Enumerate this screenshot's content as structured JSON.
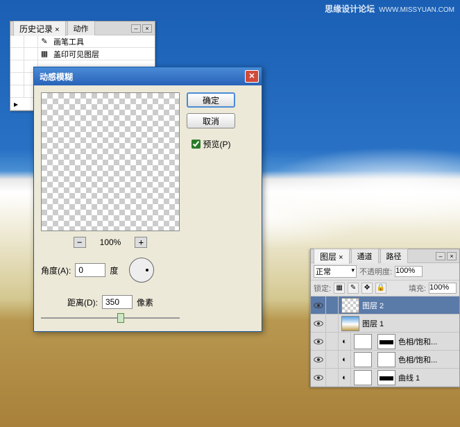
{
  "watermark": {
    "name": "思缘设计论坛",
    "url": "WWW.MISSYUAN.COM"
  },
  "history": {
    "tabs": [
      "历史记录",
      "动作"
    ],
    "items": [
      {
        "icon": "brush",
        "label": "画笔工具"
      },
      {
        "icon": "stamp",
        "label": "盖印可见图层"
      }
    ]
  },
  "dialog": {
    "title": "动感模糊",
    "ok": "确定",
    "cancel": "取消",
    "preview_label": "预览(P)",
    "zoom": "100%",
    "zoom_minus": "−",
    "zoom_plus": "+",
    "angle_label": "角度(A):",
    "angle_value": "0",
    "angle_unit": "度",
    "distance_label": "距离(D):",
    "distance_value": "350",
    "distance_unit": "像素"
  },
  "layers": {
    "tabs": [
      "图层",
      "通道",
      "路径"
    ],
    "blend_mode": "正常",
    "opacity_label": "不透明度:",
    "opacity": "100%",
    "lock_label": "锁定:",
    "fill_label": "填充:",
    "fill": "100%",
    "rows": [
      {
        "name": "图层 2",
        "thumb": "checker",
        "selected": true
      },
      {
        "name": "图层 1",
        "thumb": "sky"
      },
      {
        "name": "色相/饱和...",
        "thumb": "mask",
        "adj": true
      },
      {
        "name": "色相/饱和...",
        "thumb": "white",
        "adj": true
      },
      {
        "name": "曲线 1",
        "thumb": "mask",
        "adj": true
      }
    ]
  }
}
